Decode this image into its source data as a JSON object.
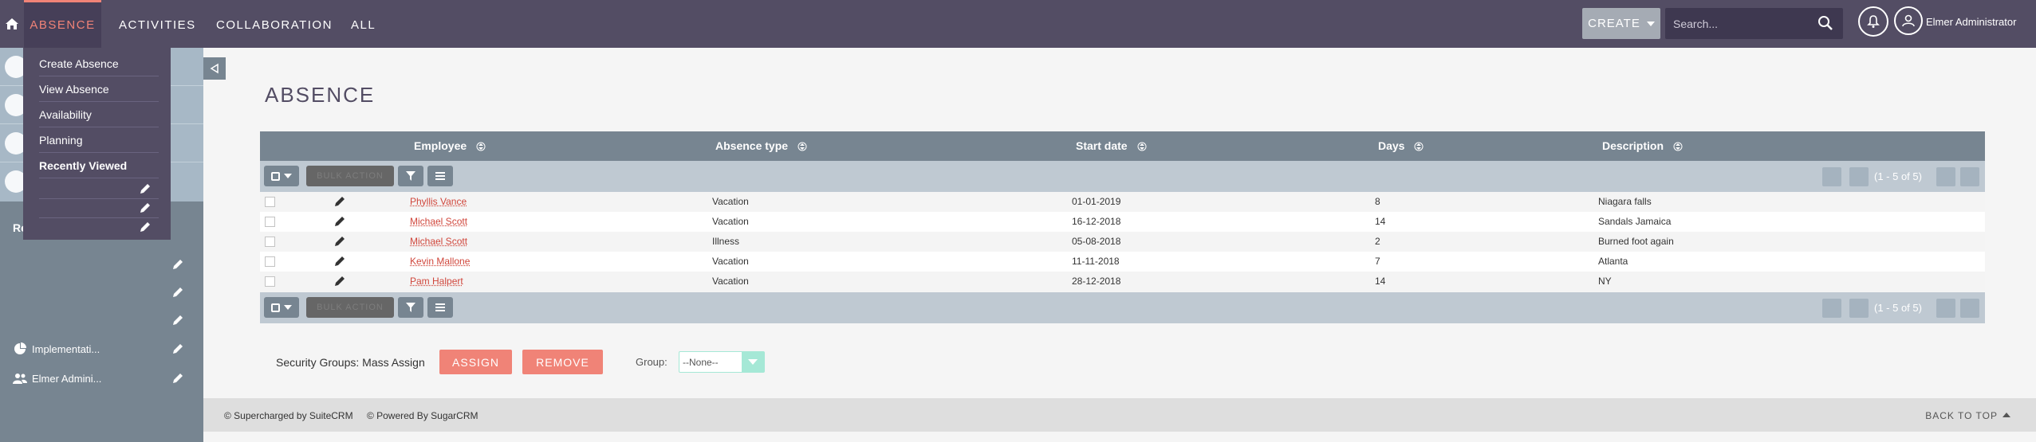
{
  "nav": {
    "tabs": [
      "ABSENCE",
      "ACTIVITIES",
      "COLLABORATION",
      "ALL"
    ],
    "create_label": "CREATE",
    "search_placeholder": "Search...",
    "user_name": "Elmer Administrator"
  },
  "dropdown": {
    "items": [
      "Create Absence",
      "View Absence",
      "Availability",
      "Planning",
      "Recently Viewed"
    ]
  },
  "sidebar": {
    "recent_label": "Re",
    "items": [
      "Implementati...",
      "Elmer Admini..."
    ]
  },
  "page": {
    "title": "ABSENCE"
  },
  "table": {
    "columns": [
      "Employee",
      "Absence type",
      "Start date",
      "Days",
      "Description"
    ],
    "bulk_action_label": "BULK ACTION",
    "pagination": "(1 - 5 of 5)",
    "rows": [
      {
        "employee": "Phyllis Vance",
        "type": "Vacation",
        "start": "01-01-2019",
        "days": "8",
        "description": "Niagara falls"
      },
      {
        "employee": "Michael Scott",
        "type": "Vacation",
        "start": "16-12-2018",
        "days": "14",
        "description": "Sandals Jamaica"
      },
      {
        "employee": "Michael Scott",
        "type": "Illness",
        "start": "05-08-2018",
        "days": "2",
        "description": "Burned foot again"
      },
      {
        "employee": "Kevin Mallone",
        "type": "Vacation",
        "start": "11-11-2018",
        "days": "7",
        "description": "Atlanta"
      },
      {
        "employee": "Pam Halpert",
        "type": "Vacation",
        "start": "28-12-2018",
        "days": "14",
        "description": "NY"
      }
    ]
  },
  "security": {
    "label": "Security Groups: Mass Assign",
    "assign_label": "ASSIGN",
    "remove_label": "REMOVE",
    "group_label": "Group:",
    "group_value": "--None--"
  },
  "footer": {
    "supercharged": "© Supercharged by SuiteCRM",
    "powered": "© Powered By SugarCRM",
    "back_to_top": "BACK TO TOP"
  },
  "colors": {
    "nav_bg": "#534d64",
    "accent": "#f08377",
    "table_header": "#778591",
    "link": "#d0463b"
  }
}
